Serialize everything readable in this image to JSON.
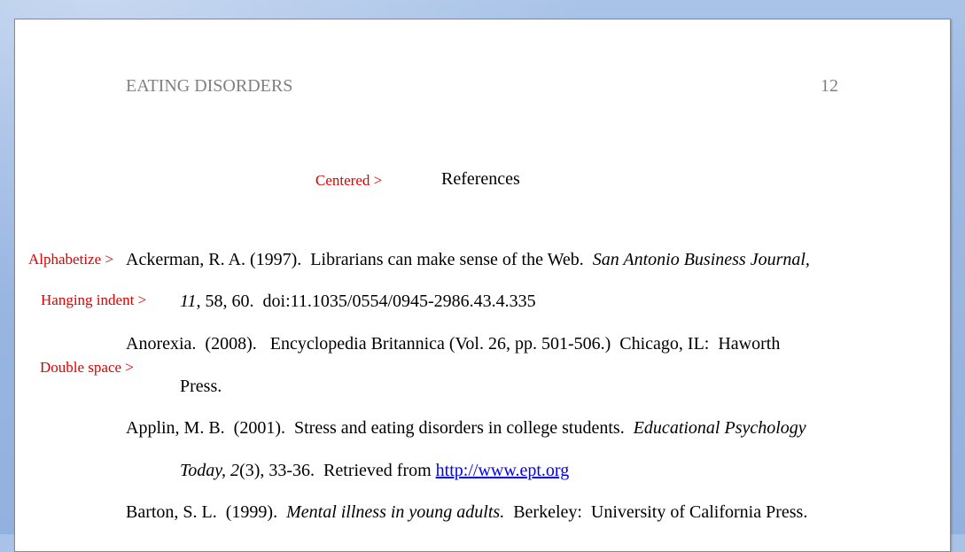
{
  "header": {
    "title": "EATING DISORDERS",
    "page_number": "12"
  },
  "annotations": {
    "centered": "Centered  >",
    "alphabetize": "Alphabetize >",
    "hanging_indent": "Hanging indent  >",
    "double_space": "Double space >"
  },
  "references": {
    "heading": "References",
    "entries": [
      {
        "line1": {
          "plain": "Ackerman, R. A. (1997).  Librarians can make sense of the Web.  ",
          "italic": "San Antonio Business Journal,"
        },
        "line2": {
          "italic": "11",
          "plain": ", 58, 60.  doi:11.1035/0554/0945-2986.43.4.335"
        }
      },
      {
        "line1": {
          "plain": "Anorexia.  (2008).   Encyclopedia Britannica (Vol. 26, pp. 501-506.)  Chicago, IL:  Haworth"
        },
        "line2": {
          "plain": "Press."
        }
      },
      {
        "line1": {
          "plain": "Applin, M. B.  (2001).  Stress and eating disorders in college students.  ",
          "italic": "Educational Psychology"
        },
        "line2": {
          "italic_a": "Today, 2",
          "plain_a": "(3), 33-36.  Retrieved from ",
          "link": "http://www.ept.org"
        }
      },
      {
        "line1": {
          "plain_a": "Barton, S. L.  (1999).  ",
          "italic": "Mental illness in young adults.",
          "plain_b": "  Berkeley:  University of California Press."
        }
      }
    ]
  }
}
